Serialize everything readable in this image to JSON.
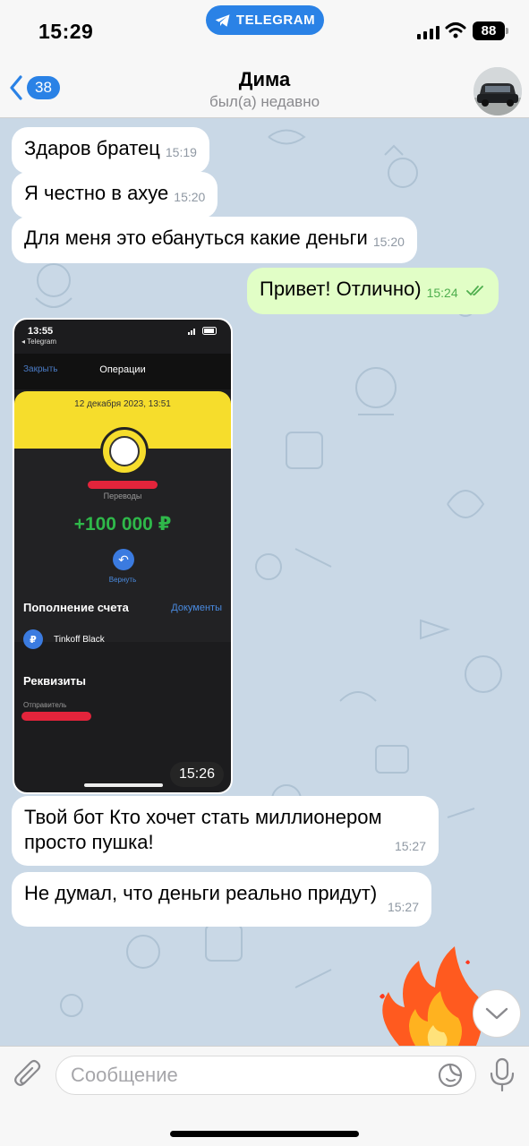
{
  "status_bar": {
    "time": "15:29",
    "app_pill": "TELEGRAM",
    "battery": "88"
  },
  "header": {
    "back_count": "38",
    "title": "Дима",
    "subtitle": "был(а) недавно"
  },
  "messages": [
    {
      "text": "Здаров братец",
      "time": "15:19",
      "direction": "in"
    },
    {
      "text": "Я честно в ахуе",
      "time": "15:20",
      "direction": "in"
    },
    {
      "text": "Для меня это ебануться какие деньги",
      "time": "15:20",
      "direction": "in"
    },
    {
      "text": "Привет! Отлично)",
      "time": "15:24",
      "direction": "out",
      "status": "read"
    },
    {
      "text": "Твой бот Кто хочет стать миллионером просто пушка!",
      "time": "15:27",
      "direction": "in"
    },
    {
      "text": "Не думал, что деньги реально придут)",
      "time": "15:27",
      "direction": "in"
    }
  ],
  "photo": {
    "time": "15:26",
    "screen": {
      "status_time": "13:55",
      "back_label": "◂ Telegram",
      "close_label": "Закрыть",
      "title": "Операции",
      "date": "12 декабря 2023, 13:51",
      "category": "Переводы",
      "amount": "+100 000 ₽",
      "return_label": "Вернуть",
      "section_topup": "Пополнение счета",
      "documents_link": "Документы",
      "account": "Tinkoff Black",
      "section_details": "Реквизиты",
      "sender_label": "Отправитель"
    }
  },
  "input": {
    "placeholder": "Сообщение"
  },
  "colors": {
    "accent": "#2a82e6",
    "outgoing_bubble": "#e1fec6",
    "chat_background": "#c9d8e6",
    "amount_green": "#2fb84a",
    "bank_yellow": "#f6dd2c"
  }
}
